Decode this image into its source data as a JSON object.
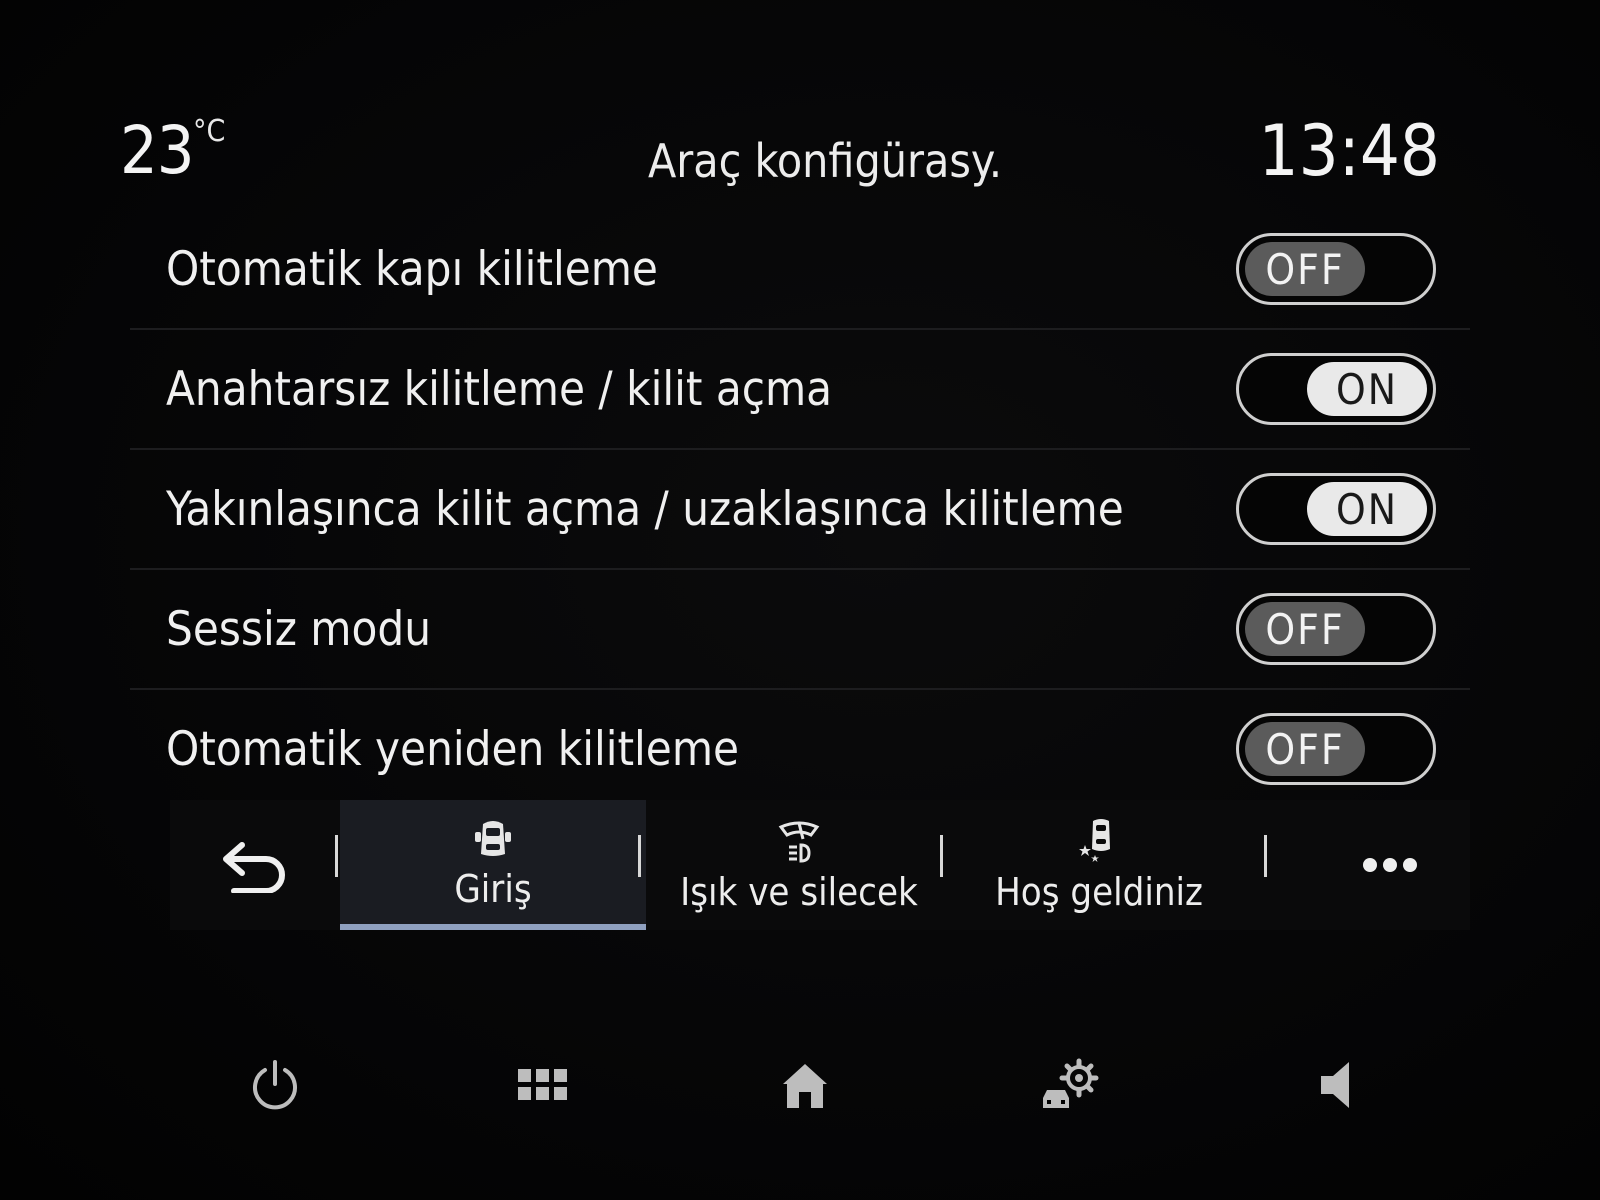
{
  "status": {
    "temperature": "23",
    "temperature_unit": "°C",
    "title": "Araç konfigürasy.",
    "time": "13:48"
  },
  "settings": [
    {
      "label": "Otomatik kapı kilitleme",
      "state": "OFF"
    },
    {
      "label": "Anahtarsız kilitleme / kilit açma",
      "state": "ON"
    },
    {
      "label": "Yakınlaşınca kilit açma / uzaklaşınca kilitleme",
      "state": "ON"
    },
    {
      "label": "Sessiz modu",
      "state": "OFF"
    },
    {
      "label": "Otomatik yeniden kilitleme",
      "state": "OFF"
    }
  ],
  "tabs": [
    {
      "label": "Giriş",
      "icon": "car-door-icon",
      "active": true
    },
    {
      "label": "Işık ve silecek",
      "icon": "light-wiper-icon",
      "active": false
    },
    {
      "label": "Hoş geldiniz",
      "icon": "welcome-icon",
      "active": false
    }
  ],
  "toolbar": {
    "back_icon": "back-arrow-icon",
    "more_icon": "more-dots-icon"
  },
  "bottom_nav": [
    {
      "icon": "power-icon"
    },
    {
      "icon": "apps-grid-icon"
    },
    {
      "icon": "home-icon"
    },
    {
      "icon": "car-settings-icon"
    },
    {
      "icon": "volume-icon"
    }
  ],
  "colors": {
    "background": "#000000",
    "text": "#f0f0f0",
    "toggle_off": "#5b5b5b",
    "toggle_on": "#e9e9e9",
    "active_tab": "#1a1c22",
    "active_tab_underline": "#8fa0c0"
  }
}
